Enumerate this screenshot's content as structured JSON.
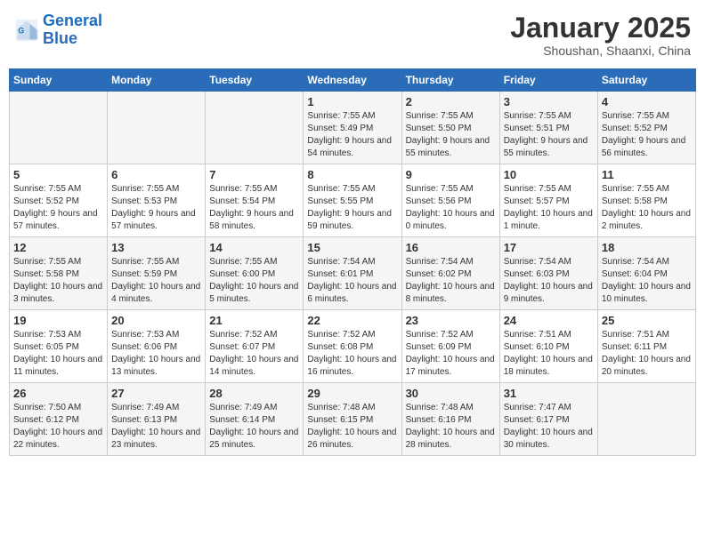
{
  "header": {
    "logo_line1": "General",
    "logo_line2": "Blue",
    "month_title": "January 2025",
    "location": "Shoushan, Shaanxi, China"
  },
  "weekdays": [
    "Sunday",
    "Monday",
    "Tuesday",
    "Wednesday",
    "Thursday",
    "Friday",
    "Saturday"
  ],
  "weeks": [
    [
      {
        "day": "",
        "sunrise": "",
        "sunset": "",
        "daylight": ""
      },
      {
        "day": "",
        "sunrise": "",
        "sunset": "",
        "daylight": ""
      },
      {
        "day": "",
        "sunrise": "",
        "sunset": "",
        "daylight": ""
      },
      {
        "day": "1",
        "sunrise": "Sunrise: 7:55 AM",
        "sunset": "Sunset: 5:49 PM",
        "daylight": "Daylight: 9 hours and 54 minutes."
      },
      {
        "day": "2",
        "sunrise": "Sunrise: 7:55 AM",
        "sunset": "Sunset: 5:50 PM",
        "daylight": "Daylight: 9 hours and 55 minutes."
      },
      {
        "day": "3",
        "sunrise": "Sunrise: 7:55 AM",
        "sunset": "Sunset: 5:51 PM",
        "daylight": "Daylight: 9 hours and 55 minutes."
      },
      {
        "day": "4",
        "sunrise": "Sunrise: 7:55 AM",
        "sunset": "Sunset: 5:52 PM",
        "daylight": "Daylight: 9 hours and 56 minutes."
      }
    ],
    [
      {
        "day": "5",
        "sunrise": "Sunrise: 7:55 AM",
        "sunset": "Sunset: 5:52 PM",
        "daylight": "Daylight: 9 hours and 57 minutes."
      },
      {
        "day": "6",
        "sunrise": "Sunrise: 7:55 AM",
        "sunset": "Sunset: 5:53 PM",
        "daylight": "Daylight: 9 hours and 57 minutes."
      },
      {
        "day": "7",
        "sunrise": "Sunrise: 7:55 AM",
        "sunset": "Sunset: 5:54 PM",
        "daylight": "Daylight: 9 hours and 58 minutes."
      },
      {
        "day": "8",
        "sunrise": "Sunrise: 7:55 AM",
        "sunset": "Sunset: 5:55 PM",
        "daylight": "Daylight: 9 hours and 59 minutes."
      },
      {
        "day": "9",
        "sunrise": "Sunrise: 7:55 AM",
        "sunset": "Sunset: 5:56 PM",
        "daylight": "Daylight: 10 hours and 0 minutes."
      },
      {
        "day": "10",
        "sunrise": "Sunrise: 7:55 AM",
        "sunset": "Sunset: 5:57 PM",
        "daylight": "Daylight: 10 hours and 1 minute."
      },
      {
        "day": "11",
        "sunrise": "Sunrise: 7:55 AM",
        "sunset": "Sunset: 5:58 PM",
        "daylight": "Daylight: 10 hours and 2 minutes."
      }
    ],
    [
      {
        "day": "12",
        "sunrise": "Sunrise: 7:55 AM",
        "sunset": "Sunset: 5:58 PM",
        "daylight": "Daylight: 10 hours and 3 minutes."
      },
      {
        "day": "13",
        "sunrise": "Sunrise: 7:55 AM",
        "sunset": "Sunset: 5:59 PM",
        "daylight": "Daylight: 10 hours and 4 minutes."
      },
      {
        "day": "14",
        "sunrise": "Sunrise: 7:55 AM",
        "sunset": "Sunset: 6:00 PM",
        "daylight": "Daylight: 10 hours and 5 minutes."
      },
      {
        "day": "15",
        "sunrise": "Sunrise: 7:54 AM",
        "sunset": "Sunset: 6:01 PM",
        "daylight": "Daylight: 10 hours and 6 minutes."
      },
      {
        "day": "16",
        "sunrise": "Sunrise: 7:54 AM",
        "sunset": "Sunset: 6:02 PM",
        "daylight": "Daylight: 10 hours and 8 minutes."
      },
      {
        "day": "17",
        "sunrise": "Sunrise: 7:54 AM",
        "sunset": "Sunset: 6:03 PM",
        "daylight": "Daylight: 10 hours and 9 minutes."
      },
      {
        "day": "18",
        "sunrise": "Sunrise: 7:54 AM",
        "sunset": "Sunset: 6:04 PM",
        "daylight": "Daylight: 10 hours and 10 minutes."
      }
    ],
    [
      {
        "day": "19",
        "sunrise": "Sunrise: 7:53 AM",
        "sunset": "Sunset: 6:05 PM",
        "daylight": "Daylight: 10 hours and 11 minutes."
      },
      {
        "day": "20",
        "sunrise": "Sunrise: 7:53 AM",
        "sunset": "Sunset: 6:06 PM",
        "daylight": "Daylight: 10 hours and 13 minutes."
      },
      {
        "day": "21",
        "sunrise": "Sunrise: 7:52 AM",
        "sunset": "Sunset: 6:07 PM",
        "daylight": "Daylight: 10 hours and 14 minutes."
      },
      {
        "day": "22",
        "sunrise": "Sunrise: 7:52 AM",
        "sunset": "Sunset: 6:08 PM",
        "daylight": "Daylight: 10 hours and 16 minutes."
      },
      {
        "day": "23",
        "sunrise": "Sunrise: 7:52 AM",
        "sunset": "Sunset: 6:09 PM",
        "daylight": "Daylight: 10 hours and 17 minutes."
      },
      {
        "day": "24",
        "sunrise": "Sunrise: 7:51 AM",
        "sunset": "Sunset: 6:10 PM",
        "daylight": "Daylight: 10 hours and 18 minutes."
      },
      {
        "day": "25",
        "sunrise": "Sunrise: 7:51 AM",
        "sunset": "Sunset: 6:11 PM",
        "daylight": "Daylight: 10 hours and 20 minutes."
      }
    ],
    [
      {
        "day": "26",
        "sunrise": "Sunrise: 7:50 AM",
        "sunset": "Sunset: 6:12 PM",
        "daylight": "Daylight: 10 hours and 22 minutes."
      },
      {
        "day": "27",
        "sunrise": "Sunrise: 7:49 AM",
        "sunset": "Sunset: 6:13 PM",
        "daylight": "Daylight: 10 hours and 23 minutes."
      },
      {
        "day": "28",
        "sunrise": "Sunrise: 7:49 AM",
        "sunset": "Sunset: 6:14 PM",
        "daylight": "Daylight: 10 hours and 25 minutes."
      },
      {
        "day": "29",
        "sunrise": "Sunrise: 7:48 AM",
        "sunset": "Sunset: 6:15 PM",
        "daylight": "Daylight: 10 hours and 26 minutes."
      },
      {
        "day": "30",
        "sunrise": "Sunrise: 7:48 AM",
        "sunset": "Sunset: 6:16 PM",
        "daylight": "Daylight: 10 hours and 28 minutes."
      },
      {
        "day": "31",
        "sunrise": "Sunrise: 7:47 AM",
        "sunset": "Sunset: 6:17 PM",
        "daylight": "Daylight: 10 hours and 30 minutes."
      },
      {
        "day": "",
        "sunrise": "",
        "sunset": "",
        "daylight": ""
      }
    ]
  ]
}
